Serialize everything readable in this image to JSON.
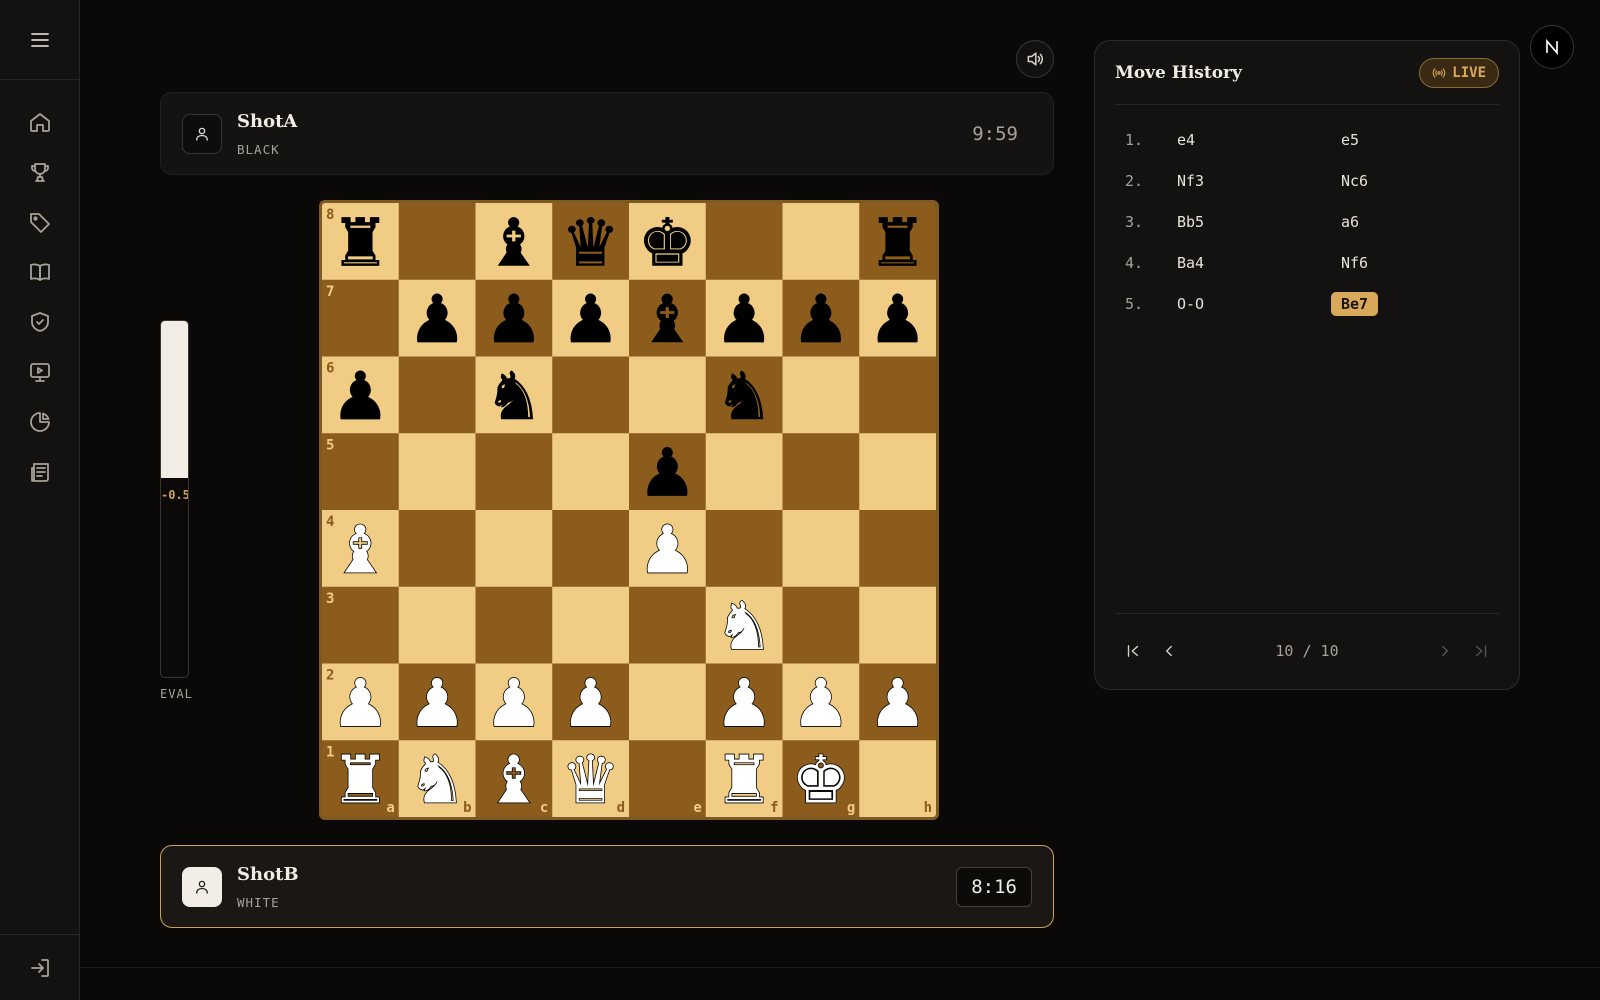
{
  "sidebar": {
    "menu_icon": "hamburger-menu-icon",
    "items": [
      {
        "icon": "home-icon"
      },
      {
        "icon": "trophy-icon"
      },
      {
        "icon": "tag-icon"
      },
      {
        "icon": "book-icon"
      },
      {
        "icon": "shield-check-icon"
      },
      {
        "icon": "monitor-play-icon"
      },
      {
        "icon": "pie-chart-icon"
      },
      {
        "icon": "newspaper-icon"
      }
    ],
    "logout_icon": "logout-icon"
  },
  "players": {
    "top": {
      "name": "ShotA",
      "color": "BLACK",
      "clock": "9:59"
    },
    "bottom": {
      "name": "ShotB",
      "color": "WHITE",
      "clock": "8:16"
    }
  },
  "eval": {
    "value": "-0.5",
    "label": "EVAL",
    "white_fraction": 0.44
  },
  "board": {
    "ranks": [
      "8",
      "7",
      "6",
      "5",
      "4",
      "3",
      "2",
      "1"
    ],
    "files": [
      "a",
      "b",
      "c",
      "d",
      "e",
      "f",
      "g",
      "h"
    ],
    "position": [
      [
        "r",
        "",
        "b",
        "q",
        "k",
        "",
        "",
        "r"
      ],
      [
        "",
        "p",
        "p",
        "p",
        "b",
        "p",
        "p",
        "p"
      ],
      [
        "p",
        "",
        "n",
        "",
        "",
        "n",
        "",
        ""
      ],
      [
        "",
        "",
        "",
        "",
        "p",
        "",
        "",
        ""
      ],
      [
        "B",
        "",
        "",
        "",
        "P",
        "",
        "",
        ""
      ],
      [
        "",
        "",
        "",
        "",
        "",
        "N",
        "",
        ""
      ],
      [
        "P",
        "P",
        "P",
        "P",
        "",
        "P",
        "P",
        "P"
      ],
      [
        "R",
        "N",
        "B",
        "Q",
        "",
        "R",
        "K",
        ""
      ]
    ],
    "colors": {
      "light": "#f0cc85",
      "dark": "#8c5c1c",
      "light_coord": "#8c5c1c",
      "dark_coord": "#f0cc85"
    }
  },
  "move_history": {
    "title": "Move History",
    "live_label": "LIVE",
    "moves": [
      {
        "num": "1.",
        "white": "e4",
        "black": "e5"
      },
      {
        "num": "2.",
        "white": "Nf3",
        "black": "Nc6"
      },
      {
        "num": "3.",
        "white": "Bb5",
        "black": "a6"
      },
      {
        "num": "4.",
        "white": "Ba4",
        "black": "Nf6"
      },
      {
        "num": "5.",
        "white": "O-O",
        "black": "Be7"
      }
    ],
    "current_move": "Be7",
    "counter": "10 / 10"
  },
  "colors": {
    "accent": "#d9a95a",
    "background": "#0a0908"
  }
}
